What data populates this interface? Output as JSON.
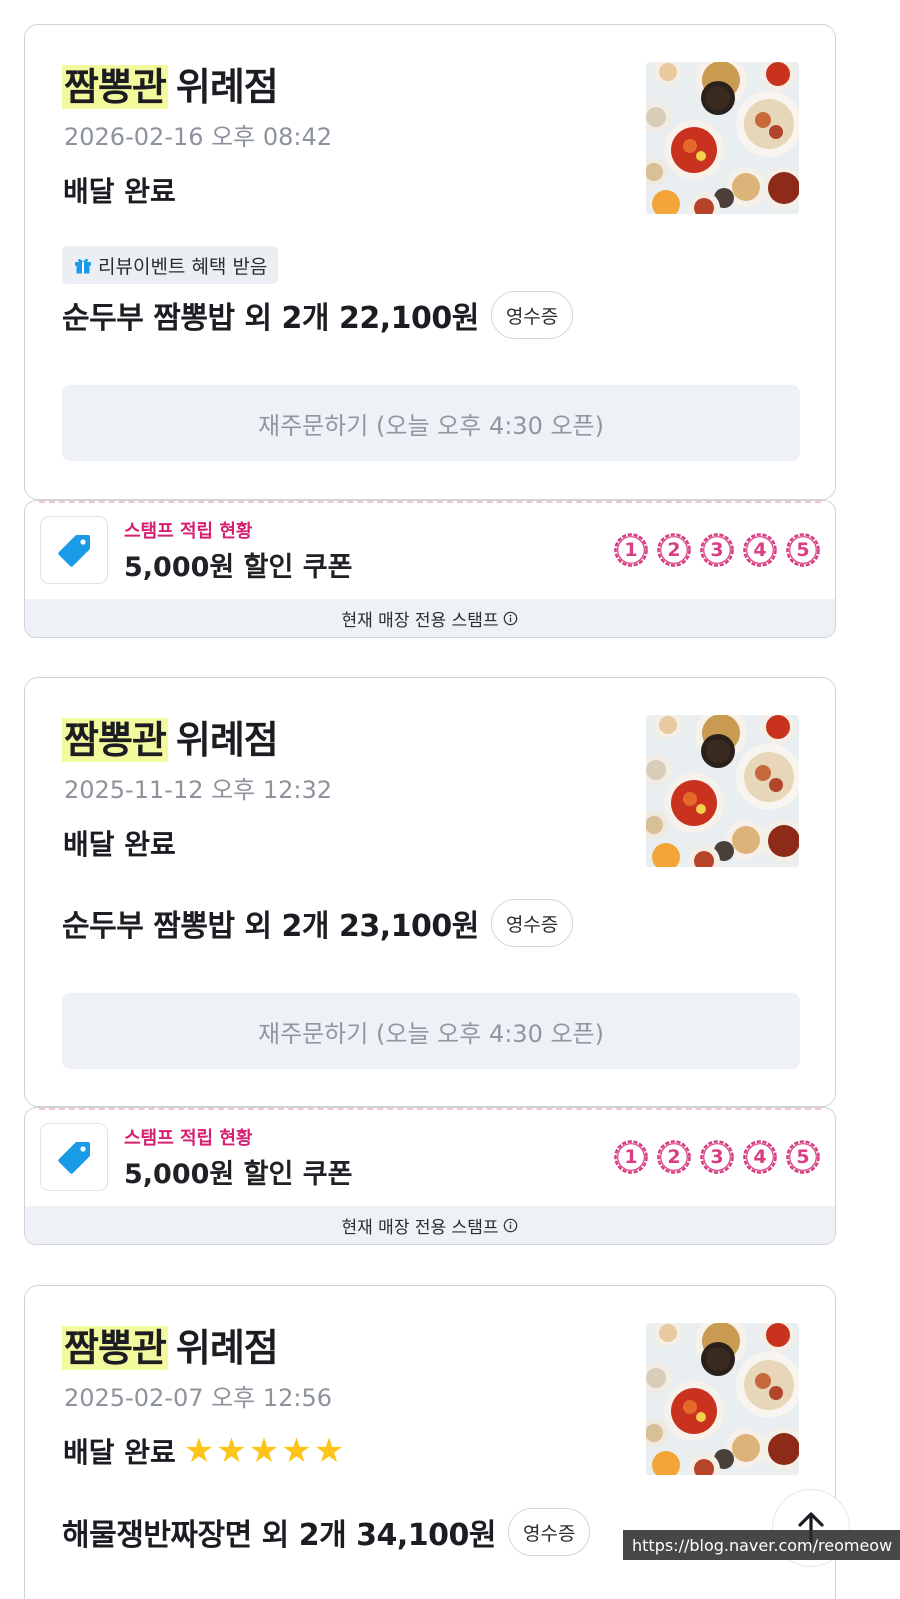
{
  "orders": [
    {
      "store_brand": "짬뽕관",
      "store_branch": "위례점",
      "date": "2026-02-16 오후 08:42",
      "status": "배달 완료",
      "event_badge": "리뷰이벤트 혜택 받음",
      "items": "순두부 짬뽕밥 외 2개 22,100원",
      "receipt_label": "영수증",
      "reorder_label": "재주문하기 (오늘 오후 4:30 오픈)",
      "stamp": {
        "title": "스탬프 적립 현황",
        "coupon": "5,000원 할인 쿠폰",
        "slots": [
          "1",
          "2",
          "3",
          "4",
          "5"
        ],
        "footer": "현재 매장 전용 스탬프"
      }
    },
    {
      "store_brand": "짬뽕관",
      "store_branch": "위례점",
      "date": "2025-11-12 오후 12:32",
      "status": "배달 완료",
      "items": "순두부 짬뽕밥 외 2개 23,100원",
      "receipt_label": "영수증",
      "reorder_label": "재주문하기 (오늘 오후 4:30 오픈)",
      "stamp": {
        "title": "스탬프 적립 현황",
        "coupon": "5,000원 할인 쿠폰",
        "slots": [
          "1",
          "2",
          "3",
          "4",
          "5"
        ],
        "footer": "현재 매장 전용 스탬프"
      }
    },
    {
      "store_brand": "짬뽕관",
      "store_branch": "위례점",
      "date": "2025-02-07 오후 12:56",
      "status": "배달 완료",
      "rating": 5,
      "items": "해물쟁반짜장면 외 2개 34,100원",
      "receipt_label": "영수증"
    }
  ],
  "watermark": "https://blog.naver.com/reomeow",
  "colors": {
    "brand_highlight": "#f3fa9e",
    "stamp_pink": "#d83e82",
    "coupon_blue": "#1a9be8",
    "star_yellow": "#ffc41a",
    "reorder_bg": "#eef2f6"
  },
  "icons": {
    "gift": "gift-icon",
    "coupon": "price-tag-icon",
    "info": "info-icon",
    "scroll_top": "arrow-up-icon"
  }
}
